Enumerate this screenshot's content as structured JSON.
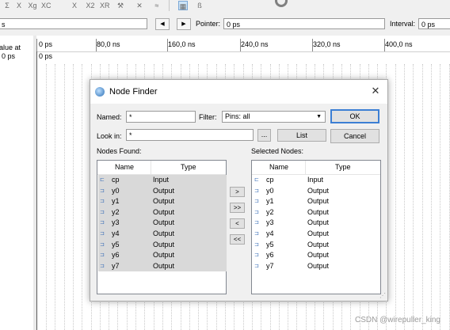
{
  "toolbar": {
    "icons": [
      "sum-icon",
      "xor-icon",
      "xnor-icon",
      "xc-icon",
      "x-icon",
      "x2-icon",
      "xr-icon",
      "hammer-icon",
      "wrench-icon",
      "waveform-icon",
      "grid-icon",
      "bus-icon"
    ],
    "glyphs": [
      "Σ",
      "X",
      "Xg",
      "XC",
      "X",
      "X2",
      "XR",
      "⚒",
      "✕",
      "≈",
      "▦",
      "ß"
    ]
  },
  "navrow": {
    "prev_glyph": "◀",
    "next_glyph": "▶",
    "pointer_label": "Pointer:",
    "pointer_value": "0 ps",
    "interval_label": "Interval:",
    "interval_value": "0 ps",
    "left_field_value": "s"
  },
  "leftpanel": {
    "header_text": "alue at",
    "value_text": "0 ps"
  },
  "timeline": {
    "labels": [
      "0 ps",
      "80,0 ns",
      "160,0 ns",
      "240,0 ns",
      "320,0 ns",
      "400,0 ns"
    ],
    "cursor_label": "0 ps"
  },
  "dialog": {
    "title": "Node Finder",
    "close_glyph": "✕",
    "named_label": "Named:",
    "named_value": "*",
    "filter_label": "Filter:",
    "filter_value": "Pins: all",
    "ok_label": "OK",
    "lookin_label": "Look in:",
    "lookin_value": "*",
    "browse_label": "...",
    "list_label": "List",
    "cancel_label": "Cancel",
    "nodes_found_label": "Nodes Found:",
    "selected_nodes_label": "Selected Nodes:",
    "col_name": "Name",
    "col_type": "Type",
    "move_one_right": ">",
    "move_all_right": ">>",
    "move_one_left": "<",
    "move_all_left": "<<",
    "nodes_found": [
      {
        "name": "cp",
        "type": "Input"
      },
      {
        "name": "y0",
        "type": "Output"
      },
      {
        "name": "y1",
        "type": "Output"
      },
      {
        "name": "y2",
        "type": "Output"
      },
      {
        "name": "y3",
        "type": "Output"
      },
      {
        "name": "y4",
        "type": "Output"
      },
      {
        "name": "y5",
        "type": "Output"
      },
      {
        "name": "y6",
        "type": "Output"
      },
      {
        "name": "y7",
        "type": "Output"
      }
    ],
    "selected_nodes": [
      {
        "name": "cp",
        "type": "Input"
      },
      {
        "name": "y0",
        "type": "Output"
      },
      {
        "name": "y1",
        "type": "Output"
      },
      {
        "name": "y2",
        "type": "Output"
      },
      {
        "name": "y3",
        "type": "Output"
      },
      {
        "name": "y4",
        "type": "Output"
      },
      {
        "name": "y5",
        "type": "Output"
      },
      {
        "name": "y6",
        "type": "Output"
      },
      {
        "name": "y7",
        "type": "Output"
      }
    ]
  },
  "watermark": "CSDN @wirepuller_king"
}
